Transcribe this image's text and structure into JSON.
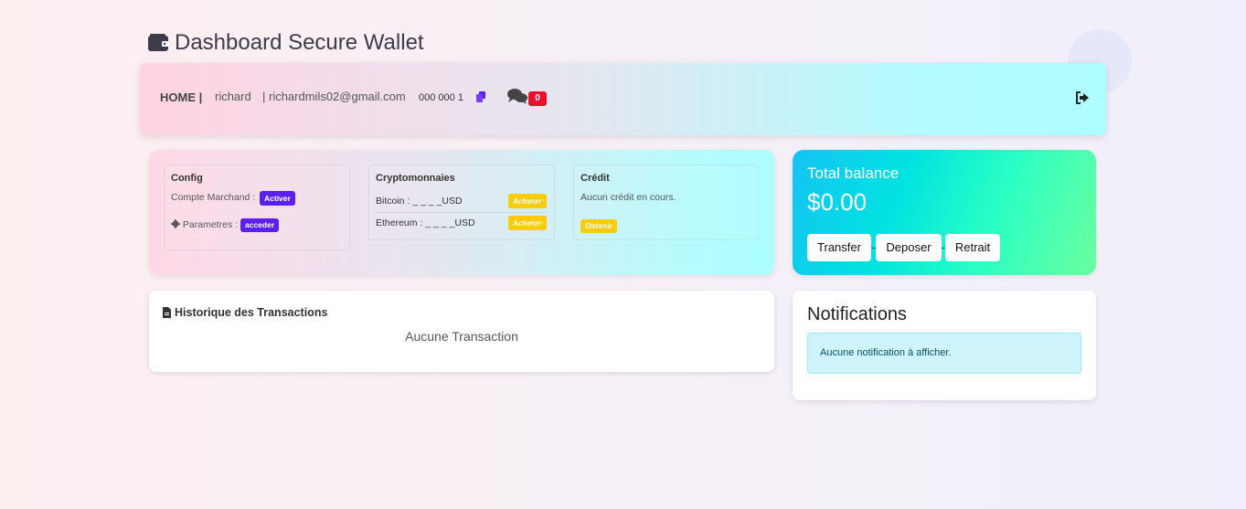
{
  "header": {
    "title": "Dashboard Secure Wallet",
    "icon": "wallet-icon"
  },
  "nav": {
    "home_label": "HOME |",
    "username": "richard",
    "email": "| richardmils02@gmail.com",
    "phone": "000 000 1",
    "messages_count": "0",
    "icons": [
      "copy-icon",
      "chat-icon",
      "logout-icon"
    ]
  },
  "services": {
    "config": {
      "title": "Config",
      "merchant_label": "Compte Marchand :",
      "merchant_action": "Activer",
      "params_label": "Parametres :",
      "params_action": "acceder"
    },
    "crypto": {
      "title": "Cryptomonnaies",
      "rows": [
        {
          "label": "Bitcoin : _ _ _ _USD",
          "action": "Acheter"
        },
        {
          "label": "Ethereum : _ _ _ _USD",
          "action": "Acheter"
        }
      ]
    },
    "credit": {
      "title": "Crédit",
      "status": "Aucun crédit en cours.",
      "action": "Obtenir"
    }
  },
  "balance": {
    "title": "Total balance",
    "amount": "$0.00",
    "actions": [
      "Transfer",
      "Deposer",
      "Retrait"
    ]
  },
  "history": {
    "title": "Historique des Transactions",
    "empty_text": "Aucune Transaction"
  },
  "notifications": {
    "title": "Notifications",
    "empty_text": "Aucune notification à afficher."
  },
  "colors": {
    "accent_purple": "#5b1ff0",
    "accent_yellow": "#f8cb0b",
    "badge_red": "#e8102c",
    "alert_bg": "#cff4fc"
  }
}
